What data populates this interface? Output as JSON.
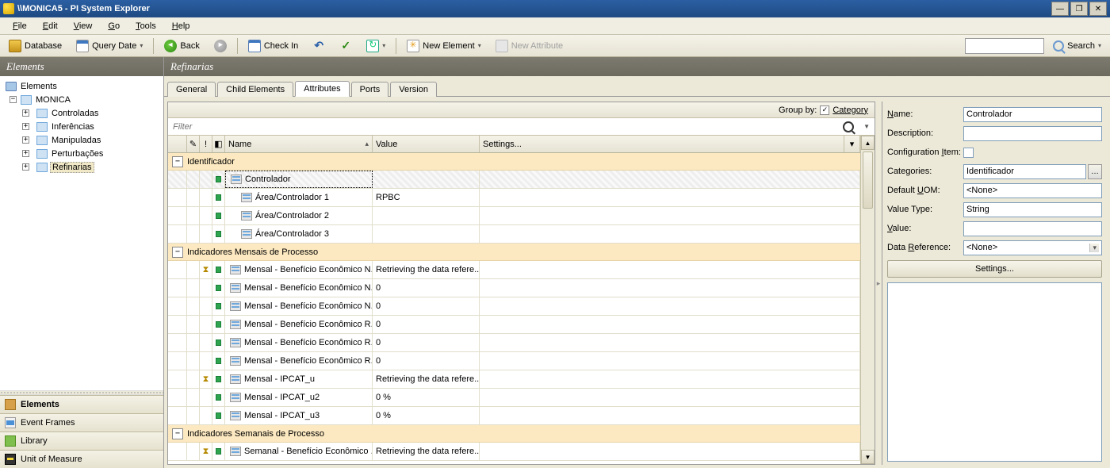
{
  "title": "\\\\MONICA5 - PI System Explorer",
  "menus": [
    "File",
    "Edit",
    "View",
    "Go",
    "Tools",
    "Help"
  ],
  "toolbar": {
    "database": "Database",
    "querydate": "Query Date",
    "back": "Back",
    "checkin": "Check In",
    "newelement": "New Element",
    "newattribute": "New Attribute",
    "search": "Search"
  },
  "left": {
    "header": "Elements",
    "root": "Elements",
    "node1": "MONICA",
    "children": [
      "Controladas",
      "Inferências",
      "Manipuladas",
      "Perturbações",
      "Refinarias"
    ],
    "nav": [
      "Elements",
      "Event Frames",
      "Library",
      "Unit of Measure"
    ]
  },
  "right": {
    "header": "Refinarias",
    "tabs": [
      "General",
      "Child Elements",
      "Attributes",
      "Ports",
      "Version"
    ],
    "activeTab": 2,
    "groupby_label": "Group by:",
    "category_label": "Category",
    "filter_placeholder": "Filter",
    "columns": {
      "name": "Name",
      "value": "Value",
      "settings": "Settings..."
    },
    "groups": [
      {
        "name": "Identificador",
        "rows": [
          {
            "name": "Controlador",
            "value": "",
            "selected": true,
            "pin": true,
            "indent": 0
          },
          {
            "name": "Área/Controlador 1",
            "value": "RPBC",
            "pin": true,
            "indent": 1
          },
          {
            "name": "Área/Controlador 2",
            "value": "",
            "pin": true,
            "indent": 1
          },
          {
            "name": "Área/Controlador 3",
            "value": "",
            "pin": true,
            "indent": 1
          }
        ]
      },
      {
        "name": "Indicadores Mensais de Processo",
        "rows": [
          {
            "name": "Mensal - Benefício Econômico N...",
            "value": "Retrieving the data refere...",
            "hourglass": true,
            "pin": true
          },
          {
            "name": "Mensal - Benefício Econômico N...",
            "value": "0",
            "pin": true
          },
          {
            "name": "Mensal - Benefício Econômico N...",
            "value": "0",
            "pin": true
          },
          {
            "name": "Mensal - Benefício Econômico R...",
            "value": "0",
            "pin": true
          },
          {
            "name": "Mensal - Benefício Econômico R...",
            "value": "0",
            "pin": true
          },
          {
            "name": "Mensal - Benefício Econômico R...",
            "value": "0",
            "pin": true
          },
          {
            "name": "Mensal - IPCAT_u",
            "value": "Retrieving the data refere...",
            "hourglass": true,
            "pin": true
          },
          {
            "name": "Mensal - IPCAT_u2",
            "value": "0 %",
            "pin": true
          },
          {
            "name": "Mensal - IPCAT_u3",
            "value": "0 %",
            "pin": true
          }
        ]
      },
      {
        "name": "Indicadores Semanais de Processo",
        "rows": [
          {
            "name": "Semanal - Benefício Econômico ...",
            "value": "Retrieving the data refere...",
            "hourglass": true,
            "pin": true
          }
        ]
      }
    ]
  },
  "props": {
    "name_l": "Name:",
    "name_v": "Controlador",
    "desc_l": "Description:",
    "desc_v": "",
    "cfg_l": "Configuration Item:",
    "cat_l": "Categories:",
    "cat_v": "Identificador",
    "uom_l": "Default UOM:",
    "uom_v": "<None>",
    "vt_l": "Value Type:",
    "vt_v": "String",
    "val_l": "Value:",
    "val_v": "",
    "dr_l": "Data Reference:",
    "dr_v": "<None>",
    "settings": "Settings..."
  }
}
